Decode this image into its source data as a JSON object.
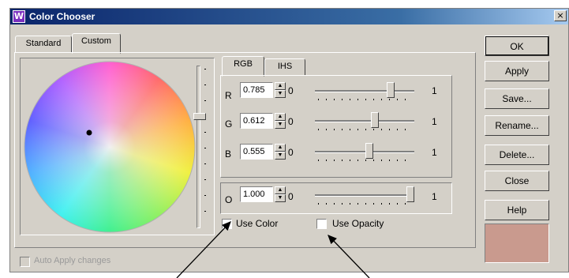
{
  "window": {
    "title": "Color Chooser",
    "app_icon": "color-chooser-icon"
  },
  "tabs": [
    {
      "label": "Standard"
    },
    {
      "label": "Custom"
    }
  ],
  "mode_tabs": [
    {
      "label": "RGB"
    },
    {
      "label": "IHS"
    }
  ],
  "channels": [
    {
      "name": "R",
      "value": "0.785",
      "min": "0",
      "max": "1",
      "level": 0.785
    },
    {
      "name": "G",
      "value": "0.612",
      "min": "0",
      "max": "1",
      "level": 0.612
    },
    {
      "name": "B",
      "value": "0.555",
      "min": "0",
      "max": "1",
      "level": 0.555
    }
  ],
  "opacity": {
    "name": "O",
    "value": "1.000",
    "min": "0",
    "max": "1",
    "level": 1.0
  },
  "checkboxes": {
    "use_color": "Use Color",
    "use_opacity": "Use Opacity",
    "auto_apply": "Auto Apply changes"
  },
  "buttons": {
    "ok": "OK",
    "apply": "Apply",
    "save": "Save...",
    "rename": "Rename...",
    "delete": "Delete...",
    "close": "Close",
    "help": "Help"
  },
  "colors": {
    "preview": "#c99a8e",
    "title_bar": "#0a246a",
    "panel": "#d4d0c8"
  }
}
